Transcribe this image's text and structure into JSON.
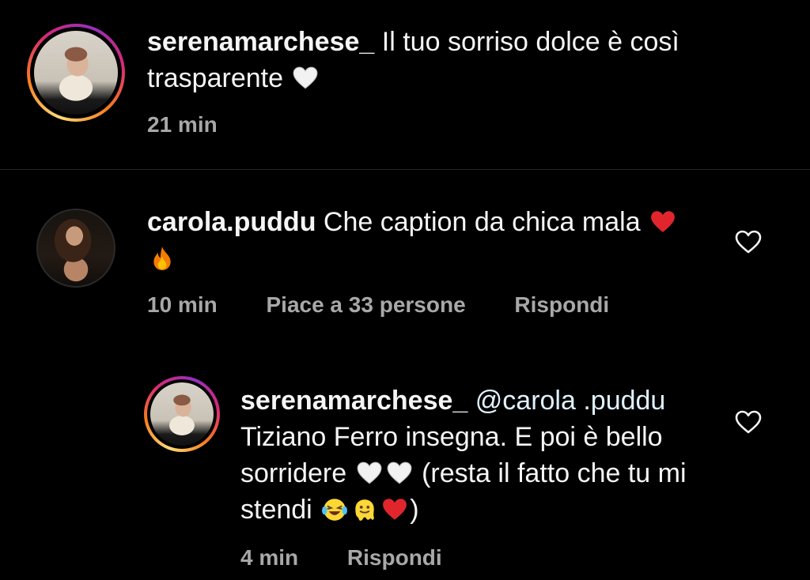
{
  "comments": [
    {
      "username": "serenamarchese_",
      "text": "Il tuo sorriso dolce è così trasparente",
      "emojis_after": [
        "white-heart"
      ],
      "time": "21 min"
    },
    {
      "username": "carola.puddu",
      "text": "Che caption da chica mala",
      "emojis_after": [
        "red-heart",
        "fire"
      ],
      "time": "10 min",
      "likes": "Piace a 33 persone",
      "reply_label": "Rispondi"
    },
    {
      "username": "serenamarchese_",
      "mention": "@carola .puddu",
      "text": "Tiziano Ferro insegna. E poi è bello sorridere",
      "text_after_hearts": "(resta il fatto che tu mi stendi",
      "closing": ")",
      "emojis": [
        "white-heart",
        "white-heart",
        "laughing-tears",
        "melting-face",
        "red-heart"
      ],
      "time": "4 min",
      "reply_label": "Rispondi"
    }
  ],
  "colors": {
    "background": "#000000",
    "text": "#f5f5f5",
    "meta": "#a8a8a8",
    "divider": "#262626"
  }
}
